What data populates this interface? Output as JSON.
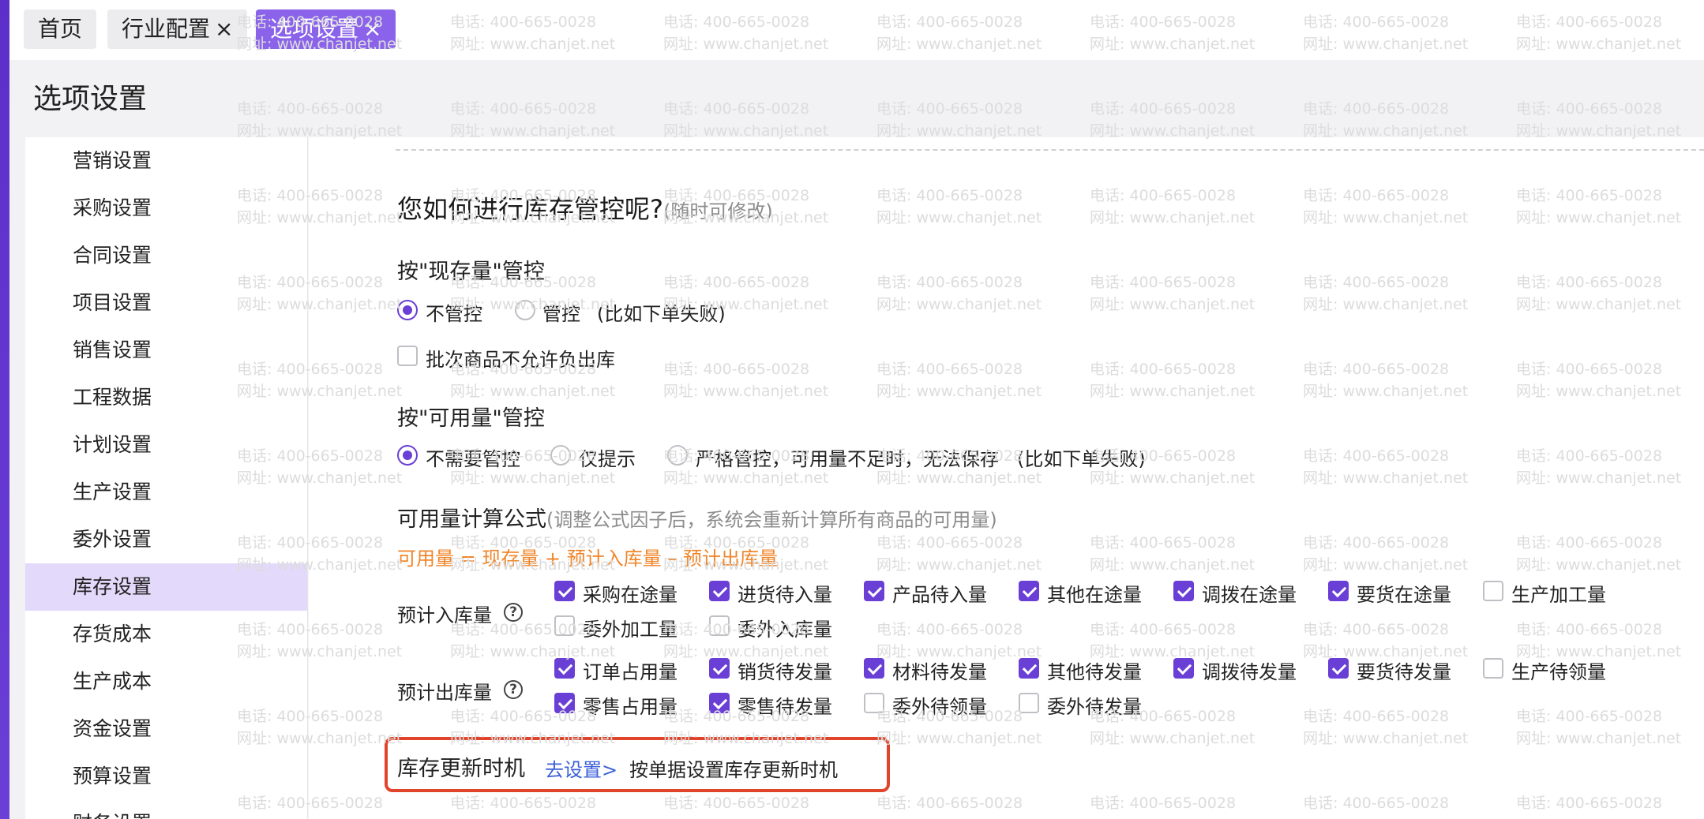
{
  "tabs": [
    {
      "label": "首页",
      "close": ""
    },
    {
      "label": "行业配置",
      "close": "×"
    },
    {
      "label": "选项设置",
      "close": "×"
    }
  ],
  "page_title": "选项设置",
  "sidebar": {
    "items": [
      {
        "label": "营销设置"
      },
      {
        "label": "采购设置"
      },
      {
        "label": "合同设置"
      },
      {
        "label": "项目设置"
      },
      {
        "label": "销售设置"
      },
      {
        "label": "工程数据"
      },
      {
        "label": "计划设置"
      },
      {
        "label": "生产设置"
      },
      {
        "label": "委外设置"
      },
      {
        "label": "库存设置",
        "active": true
      },
      {
        "label": "存货成本"
      },
      {
        "label": "生产成本"
      },
      {
        "label": "资金设置"
      },
      {
        "label": "预算设置"
      },
      {
        "label": "财务设置"
      }
    ]
  },
  "main": {
    "heading": "您如何进行库存管控呢?",
    "heading_note": "(随时可修改)",
    "stock_control": {
      "title": "按\"现存量\"管控",
      "options": [
        "不管控",
        "管控"
      ],
      "selected": 0,
      "note": "(比如下单失败)",
      "batch_checkbox": "批次商品不允许负出库",
      "batch_checked": false
    },
    "available_control": {
      "title": "按\"可用量\"管控",
      "options": [
        "不需要管控",
        "仅提示",
        "严格管控，可用量不足时，无法保存"
      ],
      "selected": 0,
      "note": "(比如下单失败)"
    },
    "formula": {
      "title": "可用量计算公式",
      "note": "(调整公式因子后，系统会重新计算所有商品的可用量)",
      "expression": "可用量 = 现存量 + 预计入库量 – 预计出库量"
    },
    "inbound": {
      "label": "预计入库量",
      "help": "?",
      "items": [
        {
          "label": "采购在途量",
          "checked": true
        },
        {
          "label": "进货待入量",
          "checked": true
        },
        {
          "label": "产品待入量",
          "checked": true
        },
        {
          "label": "其他在途量",
          "checked": true
        },
        {
          "label": "调拨在途量",
          "checked": true
        },
        {
          "label": "要货在途量",
          "checked": true
        },
        {
          "label": "生产加工量",
          "checked": false
        },
        {
          "label": "委外加工量",
          "checked": false
        },
        {
          "label": "委外入库量",
          "checked": false
        }
      ]
    },
    "outbound": {
      "label": "预计出库量",
      "help": "?",
      "items": [
        {
          "label": "订单占用量",
          "checked": true
        },
        {
          "label": "销货待发量",
          "checked": true
        },
        {
          "label": "材料待发量",
          "checked": true
        },
        {
          "label": "其他待发量",
          "checked": true
        },
        {
          "label": "调拨待发量",
          "checked": true
        },
        {
          "label": "要货待发量",
          "checked": true
        },
        {
          "label": "生产待领量",
          "checked": false
        },
        {
          "label": "零售占用量",
          "checked": true
        },
        {
          "label": "零售待发量",
          "checked": true
        },
        {
          "label": "委外待领量",
          "checked": false
        },
        {
          "label": "委外待发量",
          "checked": false
        }
      ]
    },
    "update_timing": {
      "title": "库存更新时机",
      "link": "去设置>",
      "note": "按单据设置库存更新时机"
    }
  },
  "watermark": {
    "phone": "电话: 400-665-0028",
    "site": "网址: www.chanjet.net"
  },
  "colors": {
    "accent": "#6a3fd6",
    "formula": "#f0862b",
    "highlight": "#e0452c",
    "link": "#3b5fd9"
  }
}
